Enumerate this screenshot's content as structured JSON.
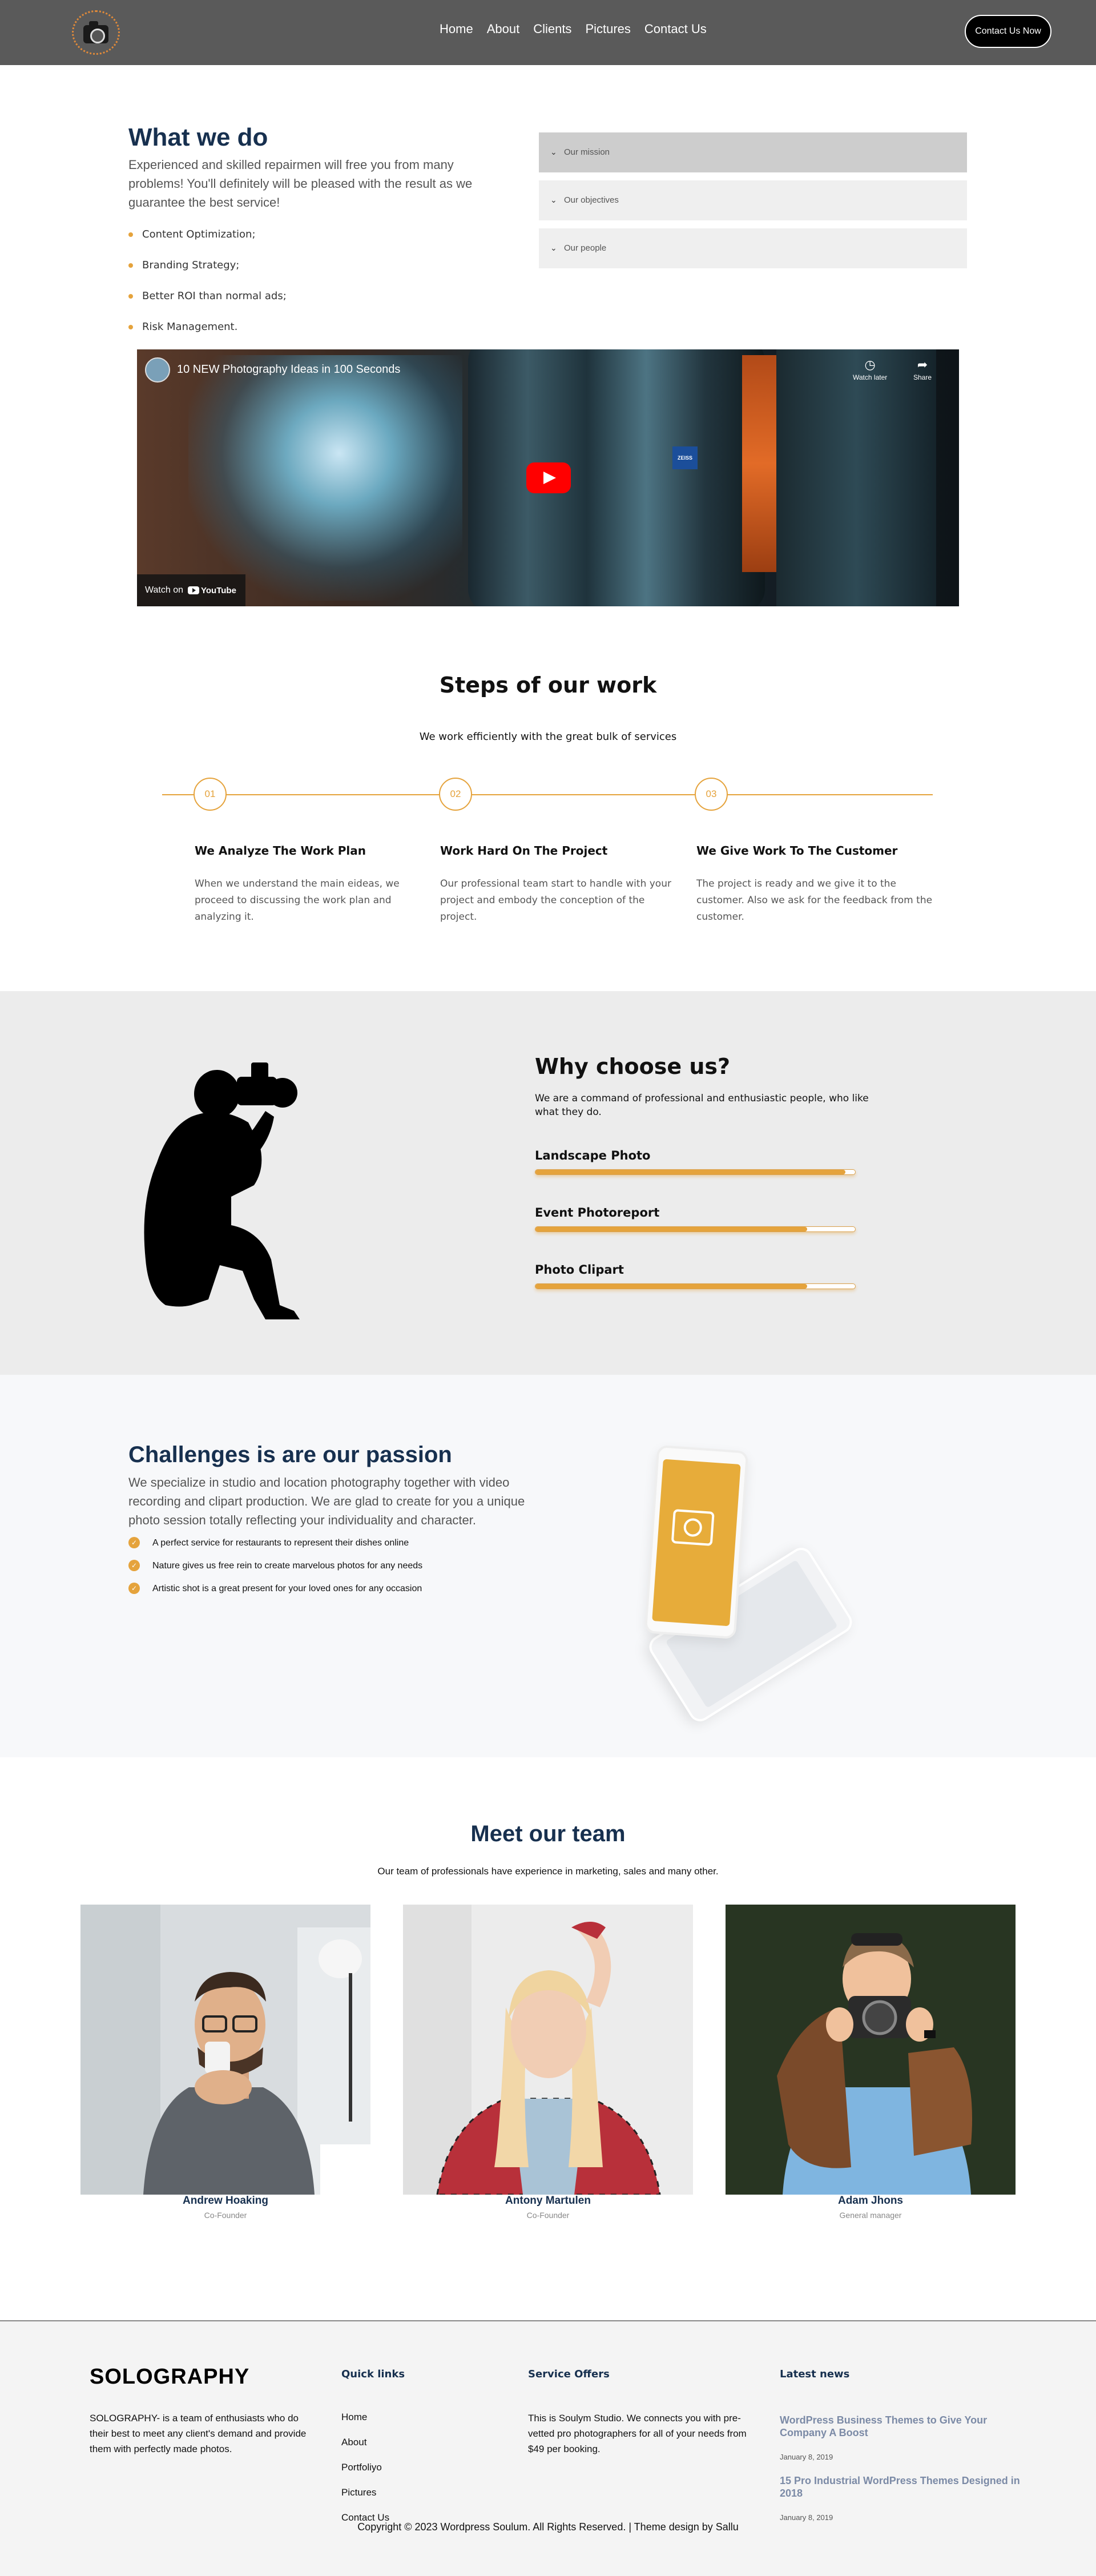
{
  "header": {
    "nav": [
      "Home",
      "About",
      "Clients",
      "Pictures",
      "Contact Us"
    ],
    "cta": "Contact Us Now",
    "bg": "#5a5a5a"
  },
  "what_we_do": {
    "title": "What we do",
    "desc": "Experienced and skilled repairmen will free you from many problems! You'll definitely will be pleased with the result as we guarantee the best service!",
    "list": [
      "Content Optimization;",
      "Branding Strategy;",
      "Better ROI than normal ads;",
      "Risk Management."
    ],
    "accordion": [
      "Our mission",
      "Our objectives",
      "Our people"
    ]
  },
  "video": {
    "title": "10 NEW Photography Ideas in 100 Seconds",
    "watch_later": "Watch later",
    "share": "Share",
    "watch_on": "Watch on",
    "youtube": "YouTube",
    "brand": "ZEISS"
  },
  "steps": {
    "title": "Steps of our work",
    "subtitle": "We work efficiently with the great bulk of services",
    "items": [
      {
        "num": "01",
        "title": "We Analyze The Work Plan",
        "text": "When we understand the main eideas, we proceed to discussing the work plan and analyzing it."
      },
      {
        "num": "02",
        "title": "Work Hard On The Project",
        "text": "Our professional team start to handle with your project and embody the conception of the project."
      },
      {
        "num": "03",
        "title": "We Give Work To The Customer",
        "text": "The project is ready and we give it to the customer. Also we ask for the feedback from the customer."
      }
    ]
  },
  "why": {
    "title": "Why choose us?",
    "desc": "We are a command of professional and enthusiastic people, who like what they do.",
    "bars": [
      {
        "label": "Landscape Photo",
        "value": 0.97
      },
      {
        "label": "Event Photoreport",
        "value": 0.85
      },
      {
        "label": "Photo Clipart",
        "value": 0.85
      }
    ]
  },
  "challenges": {
    "title": "Challenges is are our passion",
    "desc": "We specialize in studio and location photography together with video recording and clipart production. We are glad to create for you a unique photo session totally reflecting your individuality and character.",
    "list": [
      "A perfect service for restaurants to represent their dishes online",
      "Nature gives us free rein to create marvelous photos for any needs",
      "Artistic shot is a great present for your loved ones for any occasion"
    ]
  },
  "team": {
    "title": "Meet our team",
    "subtitle": "Our team of professionals have experience in marketing, sales and many other.",
    "members": [
      {
        "name": "Andrew Hoaking",
        "role": "Co-Founder"
      },
      {
        "name": "Antony Martulen",
        "role": "Co-Founder"
      },
      {
        "name": "Adam Jhons",
        "role": "General manager"
      }
    ]
  },
  "footer": {
    "brand": "SOLOGRAPHY",
    "about": "SOLOGRAPHY- is a team of enthusiasts who do their best to meet any client's demand and provide them with perfectly made photos.",
    "quick_links_title": "Quick links",
    "quick_links": [
      "Home",
      "About",
      "Portfoliyo",
      "Pictures",
      "Contact Us"
    ],
    "service_title": "Service Offers",
    "service_text": "This is Soulym Studio. We connects you with pre-vetted pro photographers for all of your needs from $49 per booking.",
    "news_title": "Latest news",
    "news": [
      {
        "title": "WordPress Business Themes to Give Your Company A Boost",
        "date": "January 8, 2019"
      },
      {
        "title": "15 Pro Industrial WordPress Themes Designed in 2018",
        "date": "January 8, 2019"
      }
    ],
    "copyright": "Copyright © 2023 Wordpress Soulum. All Rights Reserved. | Theme design by Sallu"
  },
  "colors": {
    "accent": "#e5a33c",
    "heading": "#17304f"
  }
}
